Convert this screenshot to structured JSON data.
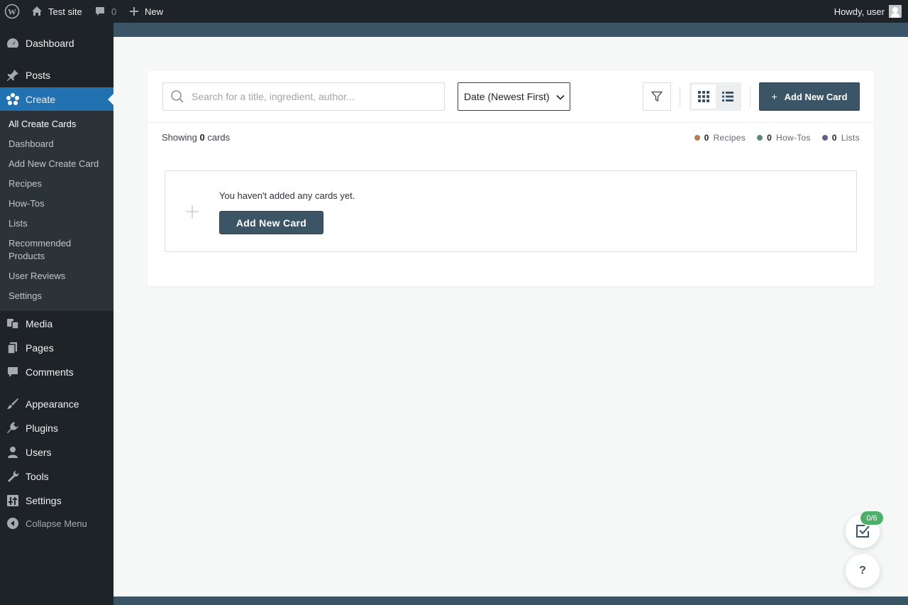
{
  "adminbar": {
    "site_name": "Test site",
    "comments_count": "0",
    "new_label": "New",
    "howdy": "Howdy, user"
  },
  "sidebar": {
    "items": [
      {
        "label": "Dashboard",
        "icon": "dashboard-icon"
      },
      {
        "label": "Posts",
        "icon": "pushpin-icon"
      },
      {
        "label": "Create",
        "icon": "create-flower-icon",
        "current": true
      },
      {
        "label": "Media",
        "icon": "media-icon"
      },
      {
        "label": "Pages",
        "icon": "pages-icon"
      },
      {
        "label": "Comments",
        "icon": "comment-icon"
      },
      {
        "label": "Appearance",
        "icon": "paintbrush-icon"
      },
      {
        "label": "Plugins",
        "icon": "plugin-icon"
      },
      {
        "label": "Users",
        "icon": "user-icon"
      },
      {
        "label": "Tools",
        "icon": "wrench-icon"
      },
      {
        "label": "Settings",
        "icon": "settings-icon"
      }
    ],
    "submenu": [
      "All Create Cards",
      "Dashboard",
      "Add New Create Card",
      "Recipes",
      "How-Tos",
      "Lists",
      "Recommended Products",
      "User Reviews",
      "Settings"
    ],
    "collapse_label": "Collapse Menu"
  },
  "toolbar": {
    "search_placeholder": "Search for a title, ingredient, author...",
    "sort_value": "Date (Newest First)",
    "add_button": "Add New Card"
  },
  "summary": {
    "showing_prefix": "Showing",
    "showing_count": "0",
    "showing_suffix": "cards",
    "counts": [
      {
        "count": "0",
        "label": "Recipes",
        "color": "#b57b52"
      },
      {
        "count": "0",
        "label": "How-Tos",
        "color": "#5b8a6f"
      },
      {
        "count": "0",
        "label": "Lists",
        "color": "#6b5b8a"
      }
    ]
  },
  "empty_state": {
    "message": "You haven't added any cards yet.",
    "button": "Add New Card"
  },
  "floating": {
    "checklist_badge": "0/6",
    "help_label": "?"
  },
  "colors": {
    "accent": "#2271b1",
    "brand_button": "#3b5566",
    "sidebar_bg": "#1d2327"
  }
}
